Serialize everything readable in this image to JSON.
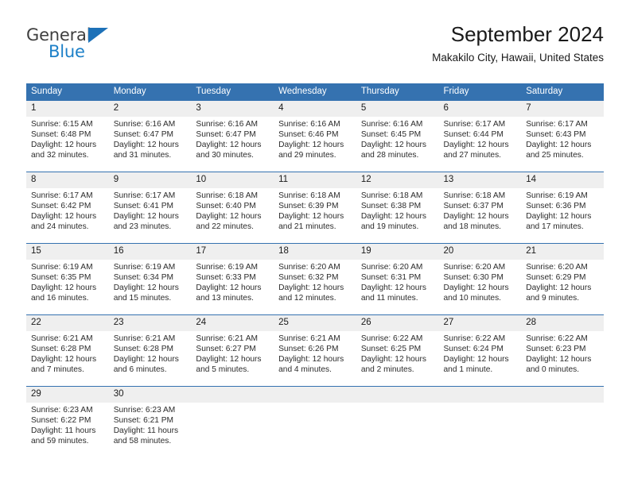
{
  "brand": {
    "name_part1": "General",
    "name_part2": "Blue",
    "colors": {
      "dark": "#3f3f3f",
      "blue": "#1d80c8",
      "triangle": "#1d71b8"
    }
  },
  "header": {
    "title": "September 2024",
    "subtitle": "Makakilo City, Hawaii, United States"
  },
  "theme": {
    "header_blue": "#3572b0",
    "daynum_band": "#efefef",
    "separator": "#3572b0"
  },
  "weekday_headers": [
    "Sunday",
    "Monday",
    "Tuesday",
    "Wednesday",
    "Thursday",
    "Friday",
    "Saturday"
  ],
  "weeks": [
    {
      "days": [
        {
          "num": "1",
          "sunrise": "Sunrise: 6:15 AM",
          "sunset": "Sunset: 6:48 PM",
          "daylight1": "Daylight: 12 hours",
          "daylight2": "and 32 minutes."
        },
        {
          "num": "2",
          "sunrise": "Sunrise: 6:16 AM",
          "sunset": "Sunset: 6:47 PM",
          "daylight1": "Daylight: 12 hours",
          "daylight2": "and 31 minutes."
        },
        {
          "num": "3",
          "sunrise": "Sunrise: 6:16 AM",
          "sunset": "Sunset: 6:47 PM",
          "daylight1": "Daylight: 12 hours",
          "daylight2": "and 30 minutes."
        },
        {
          "num": "4",
          "sunrise": "Sunrise: 6:16 AM",
          "sunset": "Sunset: 6:46 PM",
          "daylight1": "Daylight: 12 hours",
          "daylight2": "and 29 minutes."
        },
        {
          "num": "5",
          "sunrise": "Sunrise: 6:16 AM",
          "sunset": "Sunset: 6:45 PM",
          "daylight1": "Daylight: 12 hours",
          "daylight2": "and 28 minutes."
        },
        {
          "num": "6",
          "sunrise": "Sunrise: 6:17 AM",
          "sunset": "Sunset: 6:44 PM",
          "daylight1": "Daylight: 12 hours",
          "daylight2": "and 27 minutes."
        },
        {
          "num": "7",
          "sunrise": "Sunrise: 6:17 AM",
          "sunset": "Sunset: 6:43 PM",
          "daylight1": "Daylight: 12 hours",
          "daylight2": "and 25 minutes."
        }
      ]
    },
    {
      "days": [
        {
          "num": "8",
          "sunrise": "Sunrise: 6:17 AM",
          "sunset": "Sunset: 6:42 PM",
          "daylight1": "Daylight: 12 hours",
          "daylight2": "and 24 minutes."
        },
        {
          "num": "9",
          "sunrise": "Sunrise: 6:17 AM",
          "sunset": "Sunset: 6:41 PM",
          "daylight1": "Daylight: 12 hours",
          "daylight2": "and 23 minutes."
        },
        {
          "num": "10",
          "sunrise": "Sunrise: 6:18 AM",
          "sunset": "Sunset: 6:40 PM",
          "daylight1": "Daylight: 12 hours",
          "daylight2": "and 22 minutes."
        },
        {
          "num": "11",
          "sunrise": "Sunrise: 6:18 AM",
          "sunset": "Sunset: 6:39 PM",
          "daylight1": "Daylight: 12 hours",
          "daylight2": "and 21 minutes."
        },
        {
          "num": "12",
          "sunrise": "Sunrise: 6:18 AM",
          "sunset": "Sunset: 6:38 PM",
          "daylight1": "Daylight: 12 hours",
          "daylight2": "and 19 minutes."
        },
        {
          "num": "13",
          "sunrise": "Sunrise: 6:18 AM",
          "sunset": "Sunset: 6:37 PM",
          "daylight1": "Daylight: 12 hours",
          "daylight2": "and 18 minutes."
        },
        {
          "num": "14",
          "sunrise": "Sunrise: 6:19 AM",
          "sunset": "Sunset: 6:36 PM",
          "daylight1": "Daylight: 12 hours",
          "daylight2": "and 17 minutes."
        }
      ]
    },
    {
      "days": [
        {
          "num": "15",
          "sunrise": "Sunrise: 6:19 AM",
          "sunset": "Sunset: 6:35 PM",
          "daylight1": "Daylight: 12 hours",
          "daylight2": "and 16 minutes."
        },
        {
          "num": "16",
          "sunrise": "Sunrise: 6:19 AM",
          "sunset": "Sunset: 6:34 PM",
          "daylight1": "Daylight: 12 hours",
          "daylight2": "and 15 minutes."
        },
        {
          "num": "17",
          "sunrise": "Sunrise: 6:19 AM",
          "sunset": "Sunset: 6:33 PM",
          "daylight1": "Daylight: 12 hours",
          "daylight2": "and 13 minutes."
        },
        {
          "num": "18",
          "sunrise": "Sunrise: 6:20 AM",
          "sunset": "Sunset: 6:32 PM",
          "daylight1": "Daylight: 12 hours",
          "daylight2": "and 12 minutes."
        },
        {
          "num": "19",
          "sunrise": "Sunrise: 6:20 AM",
          "sunset": "Sunset: 6:31 PM",
          "daylight1": "Daylight: 12 hours",
          "daylight2": "and 11 minutes."
        },
        {
          "num": "20",
          "sunrise": "Sunrise: 6:20 AM",
          "sunset": "Sunset: 6:30 PM",
          "daylight1": "Daylight: 12 hours",
          "daylight2": "and 10 minutes."
        },
        {
          "num": "21",
          "sunrise": "Sunrise: 6:20 AM",
          "sunset": "Sunset: 6:29 PM",
          "daylight1": "Daylight: 12 hours",
          "daylight2": "and 9 minutes."
        }
      ]
    },
    {
      "days": [
        {
          "num": "22",
          "sunrise": "Sunrise: 6:21 AM",
          "sunset": "Sunset: 6:28 PM",
          "daylight1": "Daylight: 12 hours",
          "daylight2": "and 7 minutes."
        },
        {
          "num": "23",
          "sunrise": "Sunrise: 6:21 AM",
          "sunset": "Sunset: 6:28 PM",
          "daylight1": "Daylight: 12 hours",
          "daylight2": "and 6 minutes."
        },
        {
          "num": "24",
          "sunrise": "Sunrise: 6:21 AM",
          "sunset": "Sunset: 6:27 PM",
          "daylight1": "Daylight: 12 hours",
          "daylight2": "and 5 minutes."
        },
        {
          "num": "25",
          "sunrise": "Sunrise: 6:21 AM",
          "sunset": "Sunset: 6:26 PM",
          "daylight1": "Daylight: 12 hours",
          "daylight2": "and 4 minutes."
        },
        {
          "num": "26",
          "sunrise": "Sunrise: 6:22 AM",
          "sunset": "Sunset: 6:25 PM",
          "daylight1": "Daylight: 12 hours",
          "daylight2": "and 2 minutes."
        },
        {
          "num": "27",
          "sunrise": "Sunrise: 6:22 AM",
          "sunset": "Sunset: 6:24 PM",
          "daylight1": "Daylight: 12 hours",
          "daylight2": "and 1 minute."
        },
        {
          "num": "28",
          "sunrise": "Sunrise: 6:22 AM",
          "sunset": "Sunset: 6:23 PM",
          "daylight1": "Daylight: 12 hours",
          "daylight2": "and 0 minutes."
        }
      ]
    },
    {
      "days": [
        {
          "num": "29",
          "sunrise": "Sunrise: 6:23 AM",
          "sunset": "Sunset: 6:22 PM",
          "daylight1": "Daylight: 11 hours",
          "daylight2": "and 59 minutes."
        },
        {
          "num": "30",
          "sunrise": "Sunrise: 6:23 AM",
          "sunset": "Sunset: 6:21 PM",
          "daylight1": "Daylight: 11 hours",
          "daylight2": "and 58 minutes."
        },
        {
          "num": "",
          "sunrise": "",
          "sunset": "",
          "daylight1": "",
          "daylight2": ""
        },
        {
          "num": "",
          "sunrise": "",
          "sunset": "",
          "daylight1": "",
          "daylight2": ""
        },
        {
          "num": "",
          "sunrise": "",
          "sunset": "",
          "daylight1": "",
          "daylight2": ""
        },
        {
          "num": "",
          "sunrise": "",
          "sunset": "",
          "daylight1": "",
          "daylight2": ""
        },
        {
          "num": "",
          "sunrise": "",
          "sunset": "",
          "daylight1": "",
          "daylight2": ""
        }
      ]
    }
  ]
}
